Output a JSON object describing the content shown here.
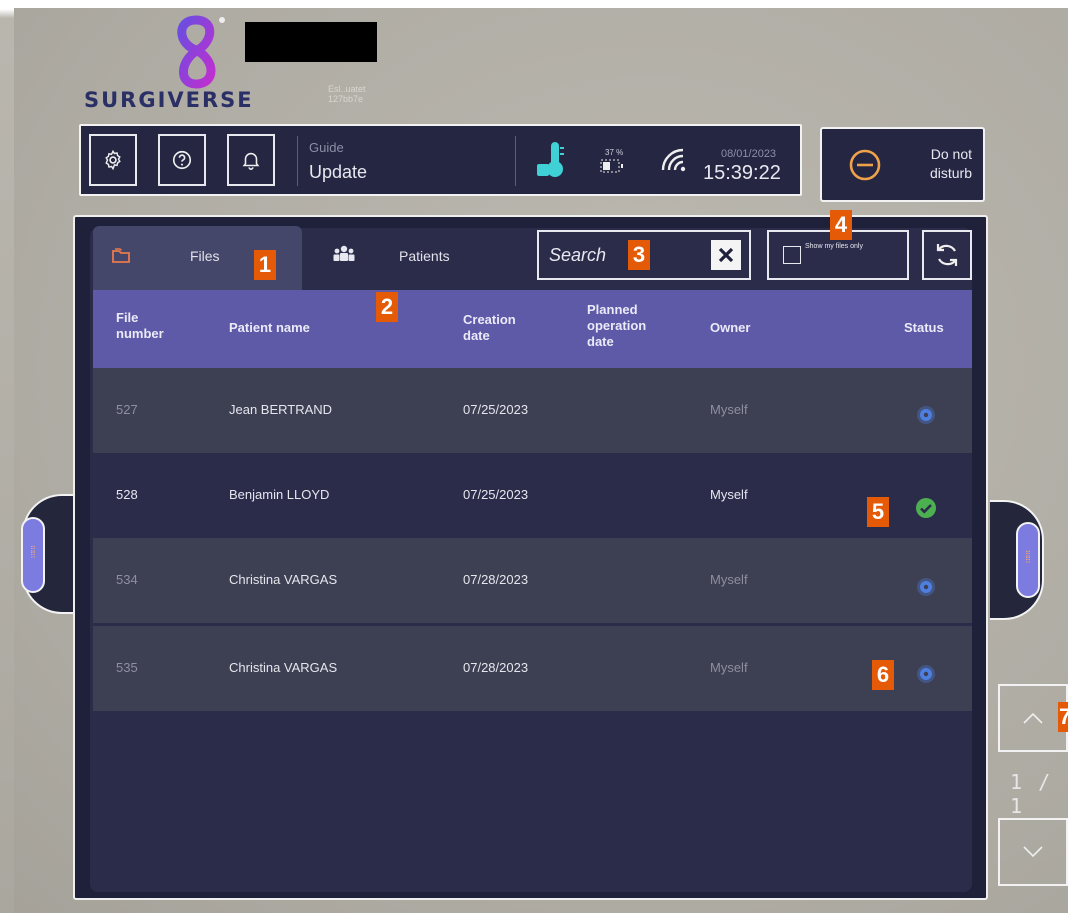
{
  "brand": {
    "name": "SURGIVERSE",
    "sub_line1": "Esl..uatet",
    "sub_line2": "127bb7e"
  },
  "topbar": {
    "guide_label": "Guide",
    "guide_value": "Update",
    "battery_percent": "37 %",
    "date": "08/01/2023",
    "time": "15:39:22"
  },
  "dnd": {
    "label": "Do not disturb"
  },
  "tabs": {
    "files": "Files",
    "patients": "Patients"
  },
  "search": {
    "placeholder": "Search"
  },
  "my_files": {
    "label": "Show my files only"
  },
  "table": {
    "headers": {
      "file_number": "File number",
      "patient_name": "Patient name",
      "creation_date": "Creation date",
      "planned_operation_date": "Planned operation date",
      "owner": "Owner",
      "status": "Status"
    },
    "rows": [
      {
        "file_number": "527",
        "patient_name": "Jean BERTRAND",
        "creation_date": "07/25/2023",
        "planned_operation_date": "",
        "owner": "Myself",
        "status": "in-progress"
      },
      {
        "file_number": "528",
        "patient_name": "Benjamin LLOYD",
        "creation_date": "07/25/2023",
        "planned_operation_date": "",
        "owner": "Myself",
        "status": "completed"
      },
      {
        "file_number": "534",
        "patient_name": "Christina VARGAS",
        "creation_date": "07/28/2023",
        "planned_operation_date": "",
        "owner": "Myself",
        "status": "in-progress"
      },
      {
        "file_number": "535",
        "patient_name": "Christina VARGAS",
        "creation_date": "07/28/2023",
        "planned_operation_date": "",
        "owner": "Myself",
        "status": "in-progress"
      }
    ]
  },
  "pagination": {
    "indicator": "1 / 1"
  },
  "annotations": [
    "1",
    "2",
    "3",
    "4",
    "5",
    "6",
    "7"
  ],
  "colors": {
    "accent": "#5e5aa8",
    "panel": "#2b2c4a",
    "status_ok": "#4caf50",
    "status_progress": "#4e7fe0",
    "annotation": "#e45a06",
    "thermometer": "#3fd1d6"
  }
}
